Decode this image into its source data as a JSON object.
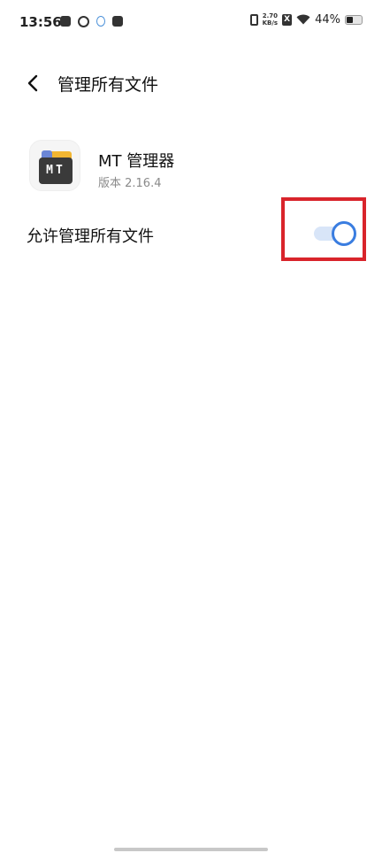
{
  "status_bar": {
    "time": "13:56",
    "net_speed_value": "2.70",
    "net_speed_unit": "KB/s",
    "sim_icon_text": "X",
    "battery_percent": "44%",
    "battery_level": 0.44,
    "icons": [
      "message-icon",
      "sync-icon",
      "avatar-icon",
      "mail-icon",
      "vibrate-icon",
      "sim-off-icon",
      "wifi-icon",
      "battery-icon"
    ]
  },
  "header": {
    "title": "管理所有文件",
    "back_icon": "chevron-left-icon"
  },
  "app": {
    "name": "MT 管理器",
    "version": "版本 2.16.4",
    "icon_label": "MT",
    "icon_colors": {
      "folder": "#f2b632",
      "tab": "#6b86d6",
      "front": "#3a3a3a"
    }
  },
  "setting": {
    "label": "允许管理所有文件",
    "toggle_on": true
  },
  "colors": {
    "accent": "#3a7de0",
    "highlight_border": "#d9242b"
  }
}
